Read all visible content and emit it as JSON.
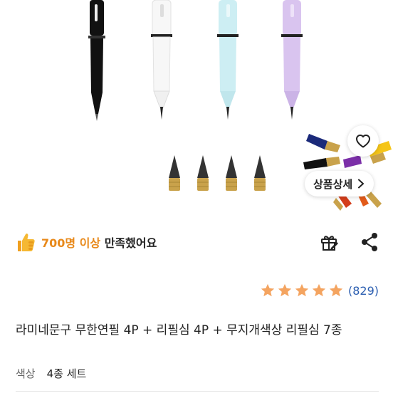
{
  "product": {
    "detail_button_label": "상품상세",
    "title": "라미네문구 무한연필 4P + 리필심 4P + 무지개색상 리필심 7종",
    "option_label": "색상",
    "option_value": "4종 세트"
  },
  "social_proof": {
    "highlight": "700명 이상",
    "rest": " 만족했어요"
  },
  "rating": {
    "stars": 5,
    "count": "(829)"
  },
  "colors": {
    "pencil_black": "#111111",
    "pencil_white": "#f7f7f7",
    "pencil_sky": "#cdeef3",
    "pencil_lavender": "#d9c4ef",
    "accent_orange": "#f4a460",
    "thumb_yellow": "#f5c518",
    "link_blue": "#2a5db0"
  },
  "icons": {
    "like": "heart-outline-icon",
    "thumbs": "thumbs-up-icon",
    "gift": "gift-icon",
    "share": "share-icon",
    "chevron": "chevron-right-icon",
    "star": "star-icon"
  }
}
